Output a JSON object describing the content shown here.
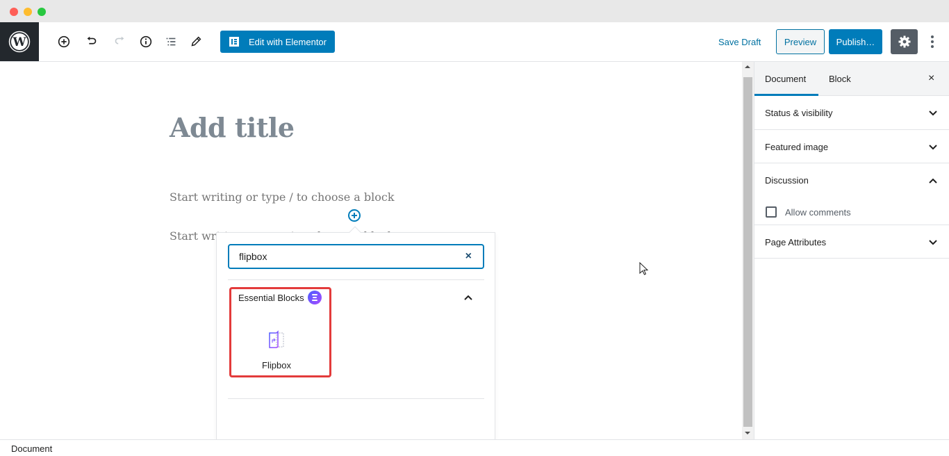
{
  "window": {
    "traffic_lights": [
      "close",
      "minimize",
      "maximize"
    ]
  },
  "toolbar": {
    "logo": "wordpress-icon",
    "tools": [
      {
        "name": "add-block",
        "icon": "plus-circle-icon"
      },
      {
        "name": "undo",
        "icon": "undo-icon"
      },
      {
        "name": "redo",
        "icon": "redo-icon",
        "disabled": true
      },
      {
        "name": "details",
        "icon": "info-icon"
      },
      {
        "name": "outline",
        "icon": "list-icon"
      },
      {
        "name": "tools",
        "icon": "pencil-icon"
      }
    ],
    "elementor_label": "Edit with Elementor",
    "save_draft_label": "Save Draft",
    "preview_label": "Preview",
    "publish_label": "Publish…",
    "settings_icon": "gear-icon",
    "more_icon": "vertical-ellipsis-icon"
  },
  "editor": {
    "title_placeholder": "Add title",
    "paragraph_placeholder_1": "Start writing or type / to choose a block",
    "paragraph_placeholder_2": "Start writing or type / to choose a block"
  },
  "inserter": {
    "search_value": "flipbox",
    "clear_icon": "×",
    "category": {
      "title": "Essential Blocks",
      "expanded": true,
      "blocks": [
        {
          "label": "Flipbox",
          "icon": "flipbox-icon"
        }
      ]
    }
  },
  "sidebar": {
    "tabs": [
      {
        "label": "Document",
        "active": true
      },
      {
        "label": "Block",
        "active": false
      }
    ],
    "close_icon": "×",
    "panels": [
      {
        "title": "Status & visibility",
        "expanded": false
      },
      {
        "title": "Featured image",
        "expanded": false
      },
      {
        "title": "Discussion",
        "expanded": true,
        "options": [
          {
            "label": "Allow comments",
            "checked": false
          }
        ]
      },
      {
        "title": "Page Attributes",
        "expanded": false
      }
    ]
  },
  "footer": {
    "breadcrumb": "Document"
  },
  "colors": {
    "accent": "#007cba",
    "highlight": "#e33b3b",
    "toolbar_dark": "#23282d",
    "settings_button": "#555d66"
  }
}
